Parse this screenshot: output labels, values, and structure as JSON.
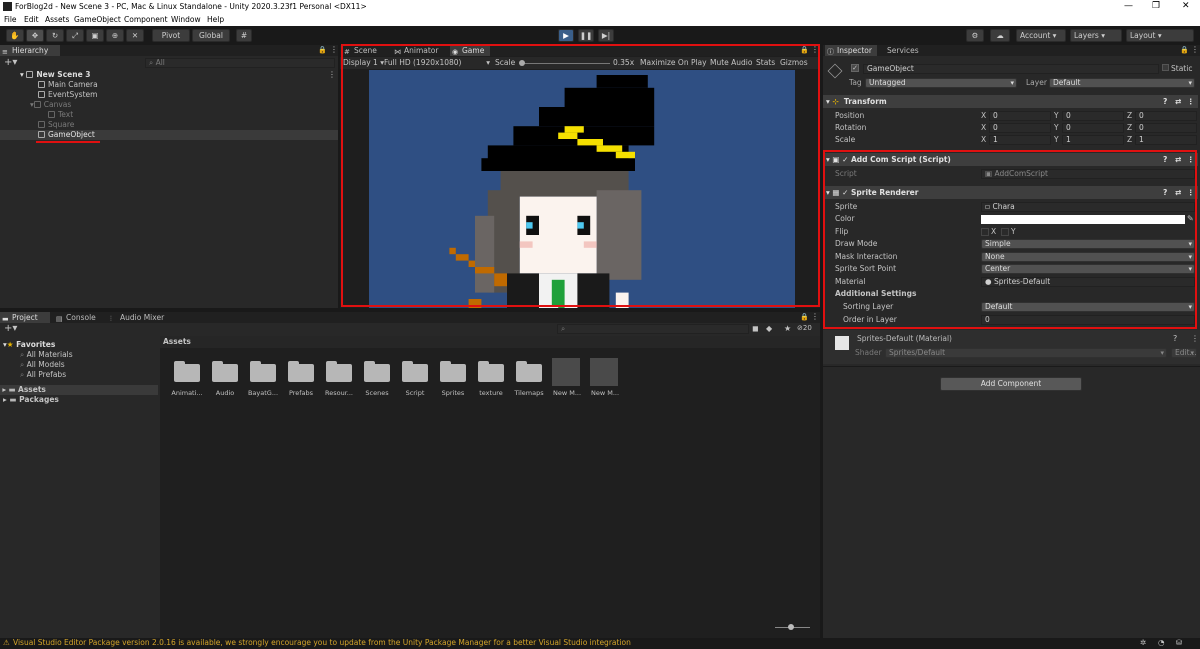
{
  "window": {
    "title": "ForBlog2d - New Scene 3 - PC, Mac & Linux Standalone - Unity 2020.3.23f1 Personal <DX11>",
    "controls": [
      "—",
      "❐",
      "✕"
    ]
  },
  "menu": [
    "File",
    "Edit",
    "Assets",
    "GameObject",
    "Component",
    "Window",
    "Help"
  ],
  "toolbar": {
    "pivot": "Pivot",
    "global": "Global",
    "account": "Account",
    "layers": "Layers",
    "layout": "Layout"
  },
  "hierarchy": {
    "tab": "Hierarchy",
    "search_placeholder": "All",
    "scene": "New Scene 3",
    "items": [
      "Main Camera",
      "EventSystem",
      "Canvas",
      "Text",
      "Square",
      "GameObject"
    ]
  },
  "game_view": {
    "tabs": [
      "Scene",
      "Animator",
      "Game"
    ],
    "display": "Display 1",
    "resolution": "Full HD (1920x1080)",
    "scale_label": "Scale",
    "scale_value": "0.35x",
    "maximize": "Maximize On Play",
    "mute": "Mute Audio",
    "stats": "Stats",
    "gizmos": "Gizmos"
  },
  "project": {
    "tabs": [
      "Project",
      "Console",
      "Audio Mixer"
    ],
    "favorites_label": "Favorites",
    "favorites": [
      "All Materials",
      "All Models",
      "All Prefabs"
    ],
    "roots": [
      "Assets",
      "Packages"
    ],
    "breadcrumb": "Assets",
    "hidden_count": "20",
    "assets": [
      "Animati...",
      "Audio",
      "BayatG...",
      "Prefabs",
      "Resour...",
      "Scenes",
      "Script",
      "Sprites",
      "texture",
      "Tilemaps",
      "New M...",
      "New M..."
    ]
  },
  "inspector": {
    "tabs": [
      "Inspector",
      "Services"
    ],
    "object_name": "GameObject",
    "static_label": "Static",
    "tag_label": "Tag",
    "tag_value": "Untagged",
    "layer_label": "Layer",
    "layer_value": "Default",
    "transform": {
      "title": "Transform",
      "rows": [
        {
          "label": "Position",
          "x": "0",
          "y": "0",
          "z": "0"
        },
        {
          "label": "Rotation",
          "x": "0",
          "y": "0",
          "z": "0"
        },
        {
          "label": "Scale",
          "x": "1",
          "y": "1",
          "z": "1"
        }
      ]
    },
    "script_comp": {
      "title": "Add Com Script (Script)",
      "script_label": "Script",
      "script_value": "AddComScript"
    },
    "sprite_renderer": {
      "title": "Sprite Renderer",
      "sprite_label": "Sprite",
      "sprite_value": "Chara",
      "color_label": "Color",
      "flip_label": "Flip",
      "flip_x": "X",
      "flip_y": "Y",
      "draw_mode_label": "Draw Mode",
      "draw_mode_value": "Simple",
      "mask_label": "Mask Interaction",
      "mask_value": "None",
      "sort_point_label": "Sprite Sort Point",
      "sort_point_value": "Center",
      "material_label": "Material",
      "material_value": "Sprites-Default",
      "additional_label": "Additional Settings",
      "sorting_layer_label": "Sorting Layer",
      "sorting_layer_value": "Default",
      "order_label": "Order in Layer",
      "order_value": "0"
    },
    "material": {
      "title": "Sprites-Default (Material)",
      "shader_label": "Shader",
      "shader_value": "Sprites/Default",
      "edit": "Edit..."
    },
    "add_component": "Add Component"
  },
  "status_bar": {
    "message": "Visual Studio Editor Package version 2.0.16 is available, we strongly encourage you to update from the Unity Package Manager for a better Visual Studio integration"
  },
  "colors": {
    "highlight_red": "#e01010",
    "game_bg": "#2f4f83",
    "warning": "#f0b400"
  }
}
